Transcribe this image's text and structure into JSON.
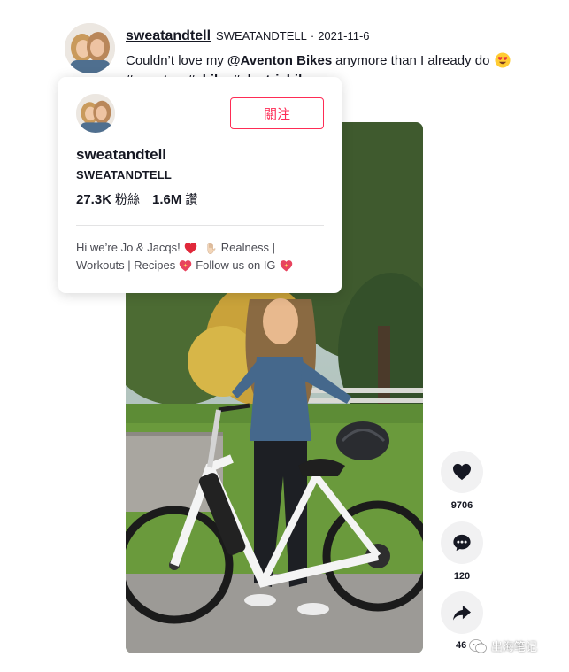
{
  "post": {
    "username": "sweatandtell",
    "handle": "SWEATANDTELL",
    "separator": "·",
    "date": "2021-11-6",
    "caption_before": "Couldn’t love my",
    "caption_mention": "@Aventon Bikes",
    "caption_after": "anymore than I already do",
    "caption_emoji": "heart-eyes-emoji",
    "hashtags": "#aventon #ebike #electricbike"
  },
  "actions": {
    "like_count": "9706",
    "comment_count": "120",
    "share_count": "46"
  },
  "card": {
    "follow_label": "關注",
    "name": "sweatandtell",
    "handle": "SWEATANDTELL",
    "followers": "27.3K",
    "followers_label": "粉絲",
    "likes": "1.6M",
    "likes_label": "讚",
    "bio_line1_a": "Hi we’re Jo & Jacqs!",
    "bio_line1_b": "Realness |",
    "bio_line2_a": "Workouts | Recipes",
    "bio_line2_b": "Follow us on IG"
  },
  "watermark": {
    "text": "出海笔记"
  },
  "colors": {
    "accent": "#fe2c55",
    "text": "#161823",
    "action_bg": "#f1f1f2"
  }
}
